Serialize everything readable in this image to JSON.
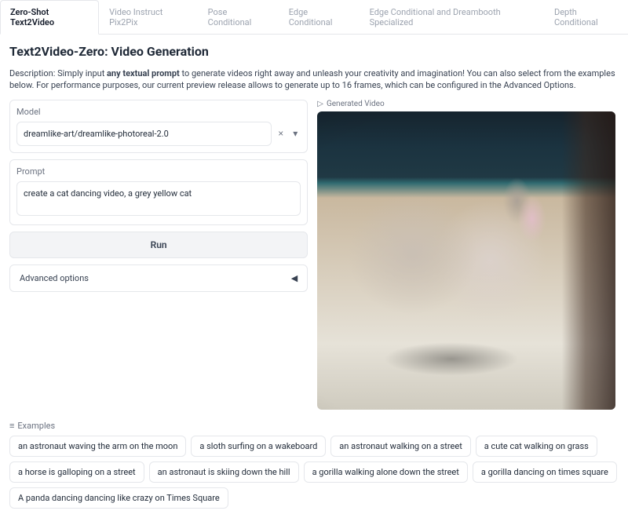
{
  "tabs": [
    {
      "label": "Zero-Shot Text2Video",
      "active": true
    },
    {
      "label": "Video Instruct Pix2Pix",
      "active": false
    },
    {
      "label": "Pose Conditional",
      "active": false
    },
    {
      "label": "Edge Conditional",
      "active": false
    },
    {
      "label": "Edge Conditional and Dreambooth Specialized",
      "active": false
    },
    {
      "label": "Depth Conditional",
      "active": false
    }
  ],
  "title": "Text2Video-Zero: Video Generation",
  "desc_prefix": "Description: Simply input ",
  "desc_bold": "any textual prompt",
  "desc_suffix": " to generate videos right away and unleash your creativity and imagination! You can also select from the examples below. For performance purposes, our current preview release allows to generate up to 16 frames, which can be configured in the Advanced Options.",
  "model": {
    "label": "Model",
    "value": "dreamlike-art/dreamlike-photoreal-2.0",
    "clear": "×",
    "caret": "▾"
  },
  "prompt": {
    "label": "Prompt",
    "value": "create a cat dancing video, a grey yellow cat"
  },
  "run_label": "Run",
  "advanced": {
    "label": "Advanced options",
    "caret": "◀"
  },
  "video": {
    "icon": "▷",
    "label": "Generated Video"
  },
  "examples_header": {
    "icon": "≡",
    "label": "Examples"
  },
  "examples": [
    "an astronaut waving the arm on the moon",
    "a sloth surfing on a wakeboard",
    "an astronaut walking on a street",
    "a cute cat walking on grass",
    "a horse is galloping on a street",
    "an astronaut is skiing down the hill",
    "a gorilla walking alone down the street",
    "a gorilla dancing on times square",
    "A panda dancing dancing like crazy on Times Square"
  ]
}
